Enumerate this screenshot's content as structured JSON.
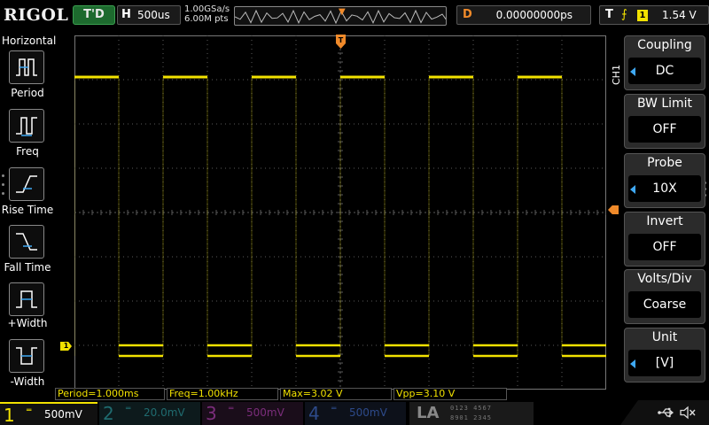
{
  "topbar": {
    "logo": "RIGOL",
    "run_state": "T'D",
    "horizontal_label": "H",
    "timebase": "500us",
    "sample_rate": "1.00GSa/s",
    "memory_depth": "6.00M pts",
    "delay_label": "D",
    "delay_value": "0.00000000ps",
    "trigger_label": "T",
    "trigger_source": "1",
    "trigger_level": "1.54 V"
  },
  "left_menu": {
    "title": "Horizontal",
    "items": [
      {
        "label": "Period",
        "icon": "period-icon"
      },
      {
        "label": "Freq",
        "icon": "frequency-icon"
      },
      {
        "label": "Rise Time",
        "icon": "rise-time-icon"
      },
      {
        "label": "Fall Time",
        "icon": "fall-time-icon"
      },
      {
        "label": "+Width",
        "icon": "positive-width-icon"
      },
      {
        "label": "-Width",
        "icon": "negative-width-icon"
      }
    ]
  },
  "right_menu": {
    "channel_tag": "CH1",
    "items": [
      {
        "title": "Coupling",
        "value": "DC",
        "has_arrow": true
      },
      {
        "title": "BW Limit",
        "value": "OFF",
        "has_arrow": false
      },
      {
        "title": "Probe",
        "value": "10X",
        "has_arrow": true
      },
      {
        "title": "Invert",
        "value": "OFF",
        "has_arrow": false
      },
      {
        "title": "Volts/Div",
        "value": "Coarse",
        "has_arrow": false
      },
      {
        "title": "Unit",
        "value": "[V]",
        "has_arrow": true
      }
    ]
  },
  "measurements": {
    "period": "Period=1.000ms",
    "freq": "Freq=1.00kHz",
    "max": "Max=3.02 V",
    "vpp": "Vpp=3.10 V"
  },
  "channels": [
    {
      "num": "1",
      "coupling": "═",
      "scale": "500mV",
      "color": "#f2e200",
      "active": true
    },
    {
      "num": "2",
      "coupling": "═",
      "scale": "20.0mV",
      "color": "#1f6b6f",
      "active": false
    },
    {
      "num": "3",
      "coupling": "═",
      "scale": "500mV",
      "color": "#7b2d7b",
      "active": false
    },
    {
      "num": "4",
      "coupling": "═",
      "scale": "500mV",
      "color": "#2d4a8a",
      "active": false
    }
  ],
  "la": {
    "label": "LA",
    "digits_row1": "0123  4567",
    "digits_row2": "8901  2345"
  },
  "ch1_marker": "1",
  "colors": {
    "trace": "#f2e200",
    "trigger": "#f08a2a",
    "accent_blue": "#3fa9f5",
    "grid": "#5a5a5a"
  },
  "waveform": {
    "period_ms": 1.0,
    "duty_cycle": 0.5,
    "high_level_v": 3.02,
    "low_level_v": -0.08,
    "timebase_us_per_div": 500
  }
}
